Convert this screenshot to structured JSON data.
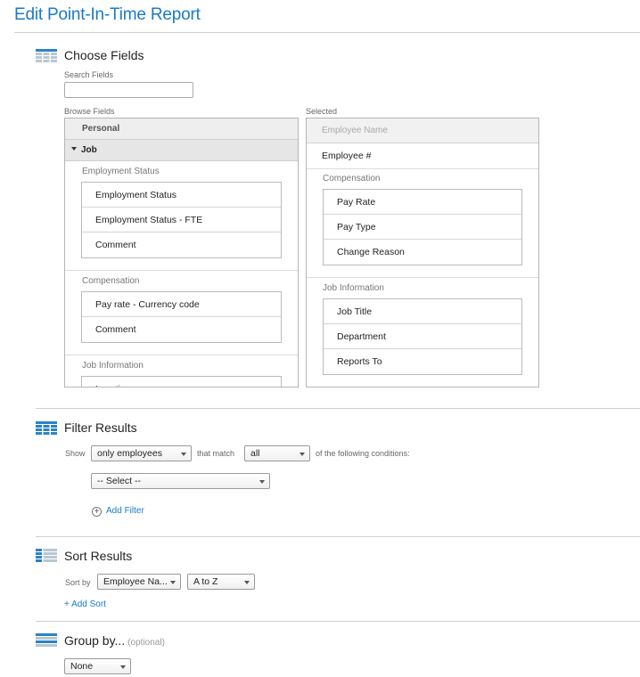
{
  "page": {
    "title": "Edit Point-In-Time Report"
  },
  "choose_fields": {
    "title": "Choose Fields",
    "search_label": "Search Fields",
    "search_value": "",
    "browse_label": "Browse Fields",
    "selected_label": "Selected",
    "browse": {
      "tab_personal": "Personal",
      "tab_job": "Job",
      "groups": [
        {
          "label": "Employment Status",
          "items": [
            "Employment Status",
            "Employment Status - FTE",
            "Comment"
          ]
        },
        {
          "label": "Compensation",
          "items": [
            "Pay rate - Currency code",
            "Comment"
          ]
        },
        {
          "label": "Job Information",
          "items": [
            "Location"
          ]
        }
      ]
    },
    "selected": {
      "header": "Employee Name",
      "item": "Employee #",
      "groups": [
        {
          "label": "Compensation",
          "items": [
            "Pay Rate",
            "Pay Type",
            "Change Reason"
          ]
        },
        {
          "label": "Job Information",
          "items": [
            "Job Title",
            "Department",
            "Reports To"
          ]
        }
      ]
    }
  },
  "filter": {
    "title": "Filter Results",
    "show_label": "Show",
    "show_value": "only employees",
    "match_label": "that match",
    "match_value": "all",
    "conditions_label": "of the following conditions:",
    "select_value": "-- Select --",
    "add_filter": "Add Filter"
  },
  "sort": {
    "title": "Sort Results",
    "sort_by_label": "Sort by",
    "field_value": "Employee Na...",
    "order_value": "A to Z",
    "add_sort": "+ Add Sort"
  },
  "group": {
    "title": "Group by...",
    "optional": "(optional)",
    "value": "None"
  },
  "colors": {
    "accent": "#1a7ac7",
    "icon_blue": "#2b82c9",
    "icon_gray": "#b9c7d3"
  }
}
